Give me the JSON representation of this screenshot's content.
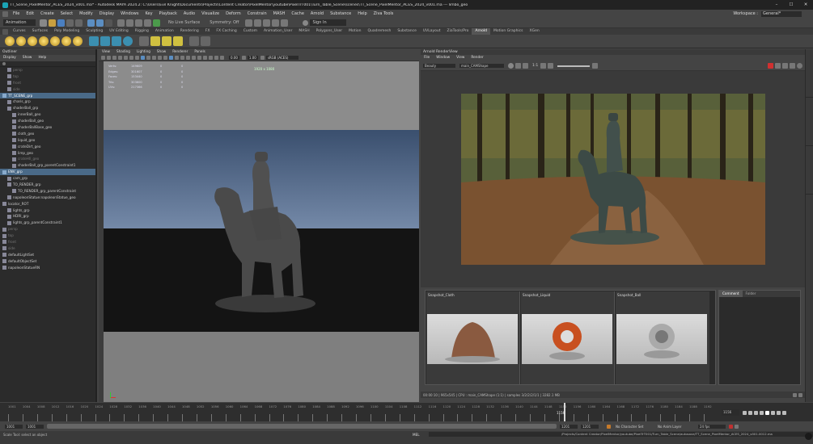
{
  "window": {
    "title": "TT_Scene_PixelMentor_ACES_2024_v001.ma* - Autodesk MAYA 2024.2: C:\\Users\\Evil Knight\\Documents\\Projects\\Content Creator\\PixelMentor\\youtube\\PixelTrT001\\Turn_Table_Scene\\scenes\\TT_Scene_PixelMentor_ACES_2024_v001.ma --- limbo_geo",
    "controls": [
      "–",
      "☐",
      "✕"
    ]
  },
  "menubar": {
    "items": [
      "File",
      "Edit",
      "Create",
      "Select",
      "Modify",
      "Display",
      "Windows",
      "Key",
      "Playback",
      "Audio",
      "Visualize",
      "Deform",
      "Constrain",
      "MASH",
      "Cache",
      "Arnold",
      "Substance",
      "Help",
      "Ziva Tools"
    ],
    "workspace_label": "Workspace :",
    "workspace_value": "General*"
  },
  "statusline": {
    "menuset": "Animation",
    "no_live_surface": "No Live Surface",
    "symmetry": "Symmetry: Off",
    "signin": "Sign In"
  },
  "shelf": {
    "tabs": [
      "Curves",
      "Surfaces",
      "Poly Modeling",
      "Sculpting",
      "UV Editing",
      "Rigging",
      "Animation",
      "Rendering",
      "FX",
      "FX Caching",
      "Custom",
      "Animation_User",
      "MASH",
      "Polygons_User",
      "Motion",
      "Quadremesh",
      "Substance",
      "UVLayout",
      "ZiaTools/Pro",
      "Arnold",
      "Motion Graphics",
      "XGen"
    ],
    "active_tab": "Arnold"
  },
  "outliner": {
    "title": "Outliner",
    "menu": [
      "Display",
      "Show",
      "Help"
    ],
    "items": [
      {
        "label": "persp",
        "dim": true,
        "indent": 1
      },
      {
        "label": "top",
        "dim": true,
        "indent": 1
      },
      {
        "label": "front",
        "dim": true,
        "indent": 1
      },
      {
        "label": "side",
        "dim": true,
        "indent": 1
      },
      {
        "label": "TT_SCENE_grp",
        "sel": true,
        "indent": 0
      },
      {
        "label": "charis_grp",
        "indent": 1
      },
      {
        "label": "shaderBall_grp",
        "indent": 1
      },
      {
        "label": "innerBall_geo",
        "indent": 2
      },
      {
        "label": "shaderBall_geo",
        "indent": 2
      },
      {
        "label": "shaderBallBase_geo",
        "indent": 2
      },
      {
        "label": "cloth_geo",
        "indent": 2
      },
      {
        "label": "liquid_geo",
        "indent": 2
      },
      {
        "label": "crateDirt_geo",
        "indent": 2
      },
      {
        "label": "limp_geo",
        "indent": 2
      },
      {
        "label": "crateHIl_geo",
        "dim": true,
        "indent": 2
      },
      {
        "label": "shaderBall_grp_parentConstraint1",
        "indent": 2
      },
      {
        "label": "ENV_grp",
        "sel": true,
        "indent": 0
      },
      {
        "label": "cam_grp",
        "indent": 1
      },
      {
        "label": "TO_RENDER_grp",
        "indent": 1
      },
      {
        "label": "TO_RENDER_grp_parentConstraint",
        "indent": 2
      },
      {
        "label": "napoleonStatue:napoleonStatue_geo",
        "indent": 1
      },
      {
        "label": "locator_ROT",
        "indent": 0
      },
      {
        "label": "lights_grp",
        "indent": 1
      },
      {
        "label": "HDRI_grp",
        "indent": 1
      },
      {
        "label": "lights_grp_parentConstraint1",
        "indent": 1
      },
      {
        "label": "persp",
        "dim": true,
        "indent": 0
      },
      {
        "label": "top",
        "dim": true,
        "indent": 0
      },
      {
        "label": "front",
        "dim": true,
        "indent": 0
      },
      {
        "label": "side",
        "dim": true,
        "indent": 0
      },
      {
        "label": "defaultLightSet",
        "indent": 0
      },
      {
        "label": "defaultObjectSet",
        "indent": 0
      },
      {
        "label": "napoleonStatueRN",
        "indent": 0
      }
    ]
  },
  "viewport": {
    "menu": [
      "View",
      "Shading",
      "Lighting",
      "Show",
      "Renderer",
      "Panels"
    ],
    "exposure": "0.00",
    "gamma": "1.00",
    "colorspace": "sRGB (ACES)",
    "resolution": "1920 x 1080",
    "hud": [
      {
        "label": "Verts:",
        "a": "149609",
        "b": "0",
        "c": "0"
      },
      {
        "label": "Edges:",
        "a": "301607",
        "b": "0",
        "c": "0"
      },
      {
        "label": "Faces:",
        "a": "153440",
        "b": "0",
        "c": "0"
      },
      {
        "label": "Tris:",
        "a": "303600",
        "b": "0",
        "c": "0"
      },
      {
        "label": "UVs:",
        "a": "217366",
        "b": "0",
        "c": "0"
      }
    ]
  },
  "arnold": {
    "title": "Arnold RenderView",
    "menu": [
      "File",
      "Window",
      "View",
      "Render"
    ],
    "aov": "Beauty",
    "camera": "main_CAMShape",
    "zoom": "1:1",
    "snapshots": [
      "Snapshot_Cloth",
      "Snapshot_Liquid",
      "Snapshot_Ball"
    ],
    "side_tabs": [
      "Comment",
      "Folder"
    ],
    "status": "00:00:10 | 965x545 | CPU : main_CAMShape (1:1) | samples 3/2/2/2/1/1 | 3282.1 MB"
  },
  "timeslider": {
    "ticks": [
      "1001",
      "1004",
      "1008",
      "1012",
      "1016",
      "1020",
      "1024",
      "1028",
      "1032",
      "1036",
      "1040",
      "1044",
      "1048",
      "1052",
      "1056",
      "1060",
      "1064",
      "1068",
      "1072",
      "1076",
      "1080",
      "1084",
      "1088",
      "1092",
      "1096",
      "1100",
      "1104",
      "1108",
      "1112",
      "1116",
      "1120",
      "1124",
      "1128",
      "1132",
      "1136",
      "1140",
      "1144",
      "1148",
      "1152",
      "1156",
      "1160",
      "1164",
      "1168",
      "1172",
      "1176",
      "1180",
      "1184",
      "1188",
      "1192"
    ],
    "current": "1156",
    "current_box": "1156"
  },
  "range": {
    "start": "1001",
    "inner_start": "1001",
    "end_inner": "1201",
    "end": "1201",
    "character_set": "No Character Set",
    "anim_layer": "No Anim Layer",
    "fps": "24 fps"
  },
  "command": {
    "lang": "MEL",
    "help": "Scale Tool: select an object",
    "path": "/Projects/Content Creator/PixelMentor/youtube/PixelTrT001/Turn_Table_Scene/autosave/TT_Scene_PixelMentor_ACES_2024_v001.0012.ma"
  },
  "colors": {
    "accent": "#4a6a88",
    "panel": "#444444",
    "dark": "#2b2b2b"
  }
}
